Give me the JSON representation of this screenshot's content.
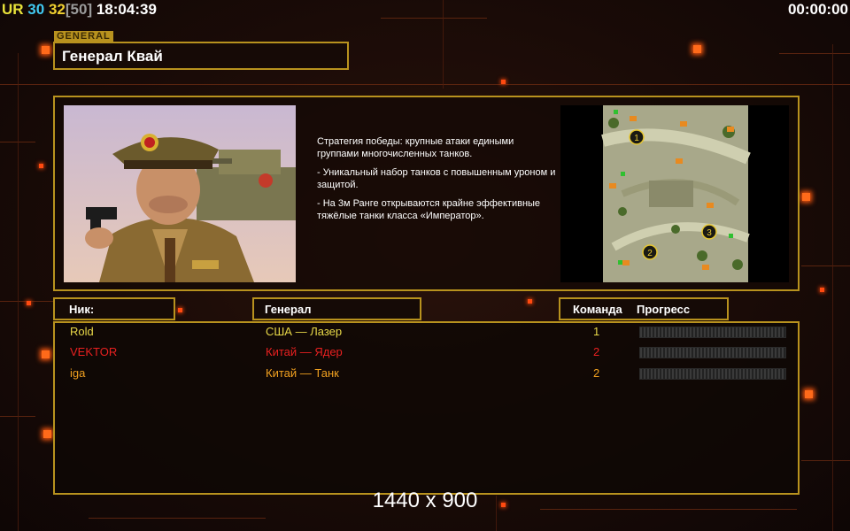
{
  "topbar": {
    "ur": "UR",
    "fps": "30",
    "fps_cur": "32",
    "fps_cap": "[50]",
    "clock": "18:04:39",
    "timer": "00:00:00"
  },
  "general": {
    "tag": "GENERAL",
    "name": "Генерал Квай",
    "description": [
      "Стратегия победы: крупные атаки едиными группами многочисленных танков.",
      "- Уникальный набор танков с повышенным уроном и защитой.",
      "- На 3м Ранге открываются крайне эффективные тяжёлые танки класса «Император»."
    ]
  },
  "headers": {
    "nick": "Ник:",
    "general": "Генерал",
    "team": "Команда",
    "progress": "Прогресс"
  },
  "players": [
    {
      "nick": "Rold",
      "general": "США — Лазер",
      "team": "1",
      "nick_color": "#e8d848",
      "gen_color": "#e8d848",
      "team_color": "#e8d848"
    },
    {
      "nick": "VEKTOR",
      "general": "Китай — Ядер",
      "team": "2",
      "nick_color": "#e82020",
      "gen_color": "#e82020",
      "team_color": "#e82020"
    },
    {
      "nick": "iga",
      "general": "Китай — Танк",
      "team": "2",
      "nick_color": "#f0a020",
      "gen_color": "#f0a020",
      "team_color": "#f0a020"
    }
  ],
  "map": {
    "markers": [
      "1",
      "2",
      "3"
    ]
  },
  "resolution": "1440 x 900",
  "colors": {
    "frame": "#b8921e",
    "accent_orange": "#ff6a1a"
  }
}
